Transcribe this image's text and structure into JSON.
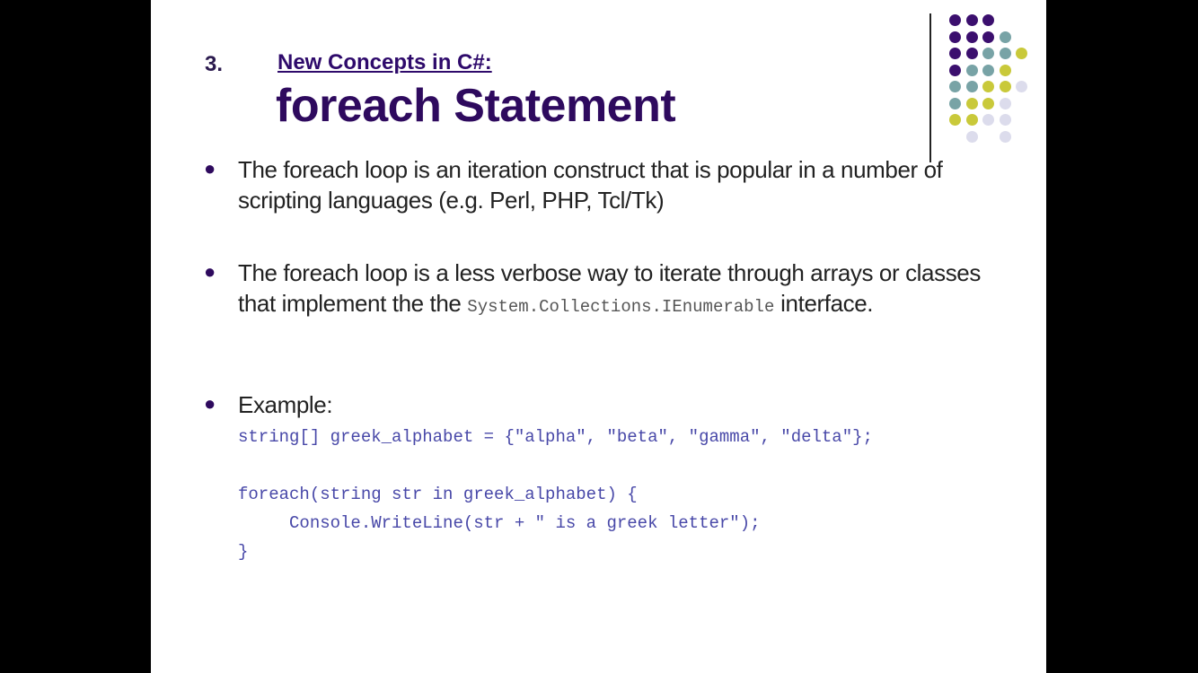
{
  "slide": {
    "number": "3.",
    "subtitle": "New Concepts in C#:",
    "title": "foreach Statement",
    "bullets": [
      {
        "text": "The foreach loop is an iteration construct that is popular in a number of scripting languages (e.g. Perl, PHP, Tcl/Tk)"
      },
      {
        "text_before": "The foreach loop is a less verbose way to iterate through arrays or classes that implement the the ",
        "code": "System.Collections.IEnumerable",
        "text_after": " interface."
      },
      {
        "text": "Example:"
      }
    ],
    "code_lines": [
      "string[] greek_alphabet = {\"alpha\", \"beta\", \"gamma\", \"delta\"};",
      "",
      "foreach(string str in greek_alphabet) {",
      "     Console.WriteLine(str + \" is a greek letter\");",
      "}"
    ]
  },
  "colors": {
    "purple": "#3b0f6e",
    "teal": "#78a3a6",
    "yellow": "#c9c93a",
    "lavender": "#dcdcec"
  },
  "dot_grid": [
    "PPP..",
    "PPPT.",
    "PPTTY",
    "PTTY.",
    "TTYYL",
    "TYYL.",
    "YYLL.",
    ".L.L."
  ]
}
